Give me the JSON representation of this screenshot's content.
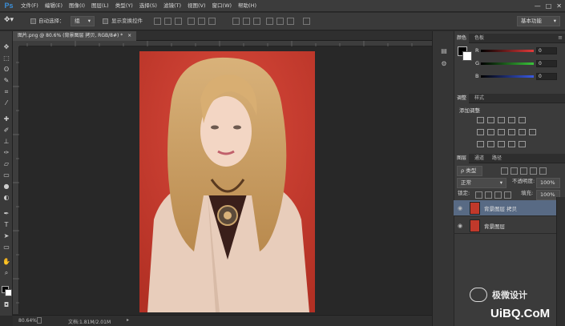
{
  "app": {
    "logo": "Ps"
  },
  "menu": {
    "items": [
      "文件(F)",
      "编辑(E)",
      "图像(I)",
      "图层(L)",
      "类型(Y)",
      "选择(S)",
      "滤镜(T)",
      "视图(V)",
      "窗口(W)",
      "帮助(H)"
    ]
  },
  "window_controls": {
    "minimize": "—",
    "maximize": "□",
    "close": "✕"
  },
  "options_bar": {
    "auto_select_label": "自动选择：",
    "auto_select_value": "组",
    "show_transform_label": "显示变换控件",
    "workspace": "基本功能"
  },
  "document": {
    "tab_label": "图片.png @ 80.6% (背景图层 拷贝, RGB/8#) *",
    "close": "×"
  },
  "status_bar": {
    "zoom": "80.64%",
    "doc_info": "文档:1.81M/2.01M"
  },
  "color_panel": {
    "tabs": [
      "颜色",
      "色板"
    ],
    "channels": [
      {
        "name": "R",
        "value": "0",
        "color": "#e23a3a"
      },
      {
        "name": "G",
        "value": "0",
        "color": "#3ac43a"
      },
      {
        "name": "B",
        "value": "0",
        "color": "#3a5ae2"
      }
    ]
  },
  "adjust_panel": {
    "tabs": [
      "调整",
      "样式"
    ],
    "title": "添加调整"
  },
  "layers_panel": {
    "tabs": [
      "图层",
      "通道",
      "路径"
    ],
    "filter_label": "ρ 类型",
    "blend_mode": "正常",
    "opacity_label": "不透明度:",
    "opacity_value": "100%",
    "lock_label": "锁定:",
    "fill_label": "填充:",
    "fill_value": "100%",
    "layers": [
      {
        "name": "背景图层 拷贝",
        "selected": true
      },
      {
        "name": "背景图层",
        "selected": false
      }
    ]
  },
  "watermark": {
    "brand_text": "极微设计",
    "site_text": "UiBQ.CoM"
  },
  "colors": {
    "canvas_red": "#c93a2e",
    "selected_layer": "#586a84"
  }
}
